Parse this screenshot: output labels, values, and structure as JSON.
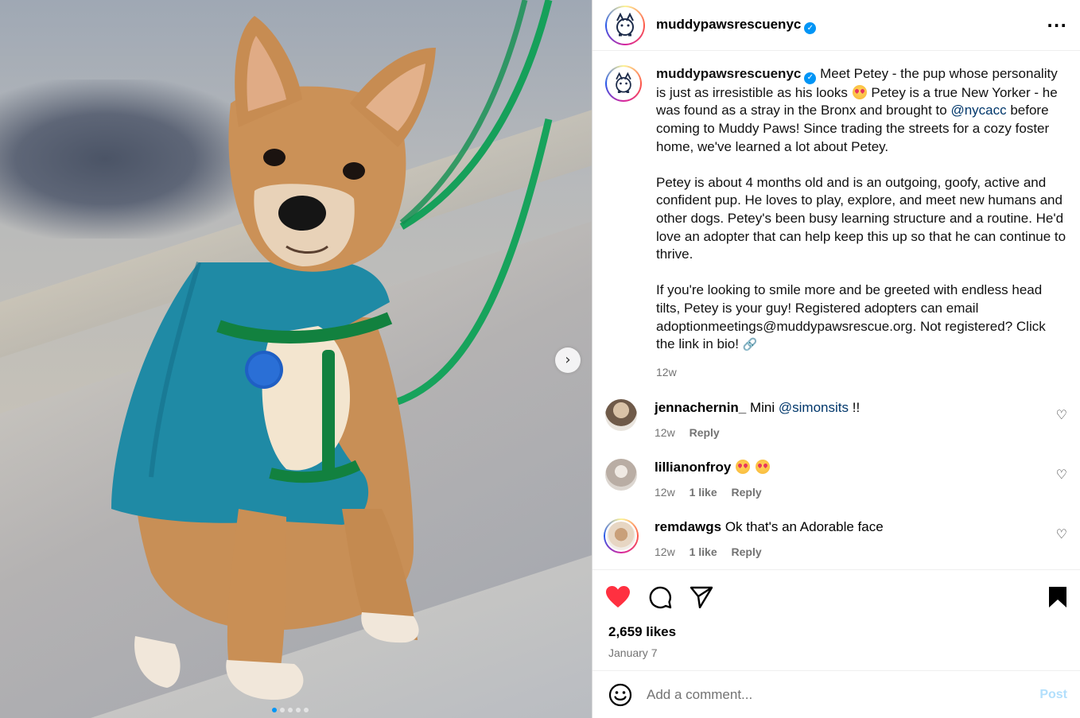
{
  "post": {
    "username": "muddypawsrescuenyc",
    "verified": true,
    "more_icon": "more-options-icon",
    "image_alt": "Dog in teal jacket with green leash",
    "carousel_dots": 5,
    "carousel_active": 0
  },
  "caption": {
    "username": "muddypawsrescuenyc",
    "part1": " Meet Petey - the pup whose personality is just as irresistible as his looks ",
    "part2": " Petey is a true New Yorker - he was found as a stray in the Bronx and brought to ",
    "mention": "@nycacc",
    "part3": " before coming to Muddy Paws! Since trading the streets for a cozy foster home, we've learned a lot about Petey.",
    "para2": "Petey is about 4 months old and is an outgoing, goofy, active and confident pup. He loves to play, explore, and meet new humans and other dogs. Petey's been busy learning structure and a routine. He'd love an adopter that can help keep this up so that he can continue to thrive.",
    "para3": "If you're looking to smile more and be greeted with endless head tilts, Petey is your guy! Registered adopters can email adoptionmeetings@muddypawsrescue.org. Not registered? Click the link in bio! ",
    "link_icon": "🔗",
    "time": "12w"
  },
  "comments": [
    {
      "username": "jennachernin_",
      "text_pre": " Mini ",
      "mention": "@simonsits",
      "text_post": " !!",
      "time": "12w",
      "likes": "",
      "reply": "Reply",
      "avatar_color": "#8a7a6a"
    },
    {
      "username": "lillianonfroy",
      "text_pre": " ",
      "mention": "",
      "text_post": "",
      "time": "12w",
      "likes": "1 like",
      "reply": "Reply",
      "avatar_color": "#b9ada4",
      "emoji_count": 2
    },
    {
      "username": "remdawgs",
      "text_pre": " Ok that's an Adorable face",
      "mention": "",
      "text_post": "",
      "time": "12w",
      "likes": "1 like",
      "reply": "Reply",
      "avatar_color": "#c9a07a"
    }
  ],
  "actions": {
    "like_icon": "heart-filled-icon",
    "comment_icon": "comment-icon",
    "share_icon": "share-icon",
    "save_icon": "bookmark-filled-icon",
    "like_color": "#ff3040"
  },
  "likes": "2,659 likes",
  "date": "January 7",
  "add_comment": {
    "placeholder": "Add a comment...",
    "post_label": "Post",
    "emoji_icon": "emoji-smile-icon"
  },
  "nav": {
    "next_icon": "chevron-right-icon",
    "next_glyph": "›"
  },
  "heart_glyph": "♡"
}
